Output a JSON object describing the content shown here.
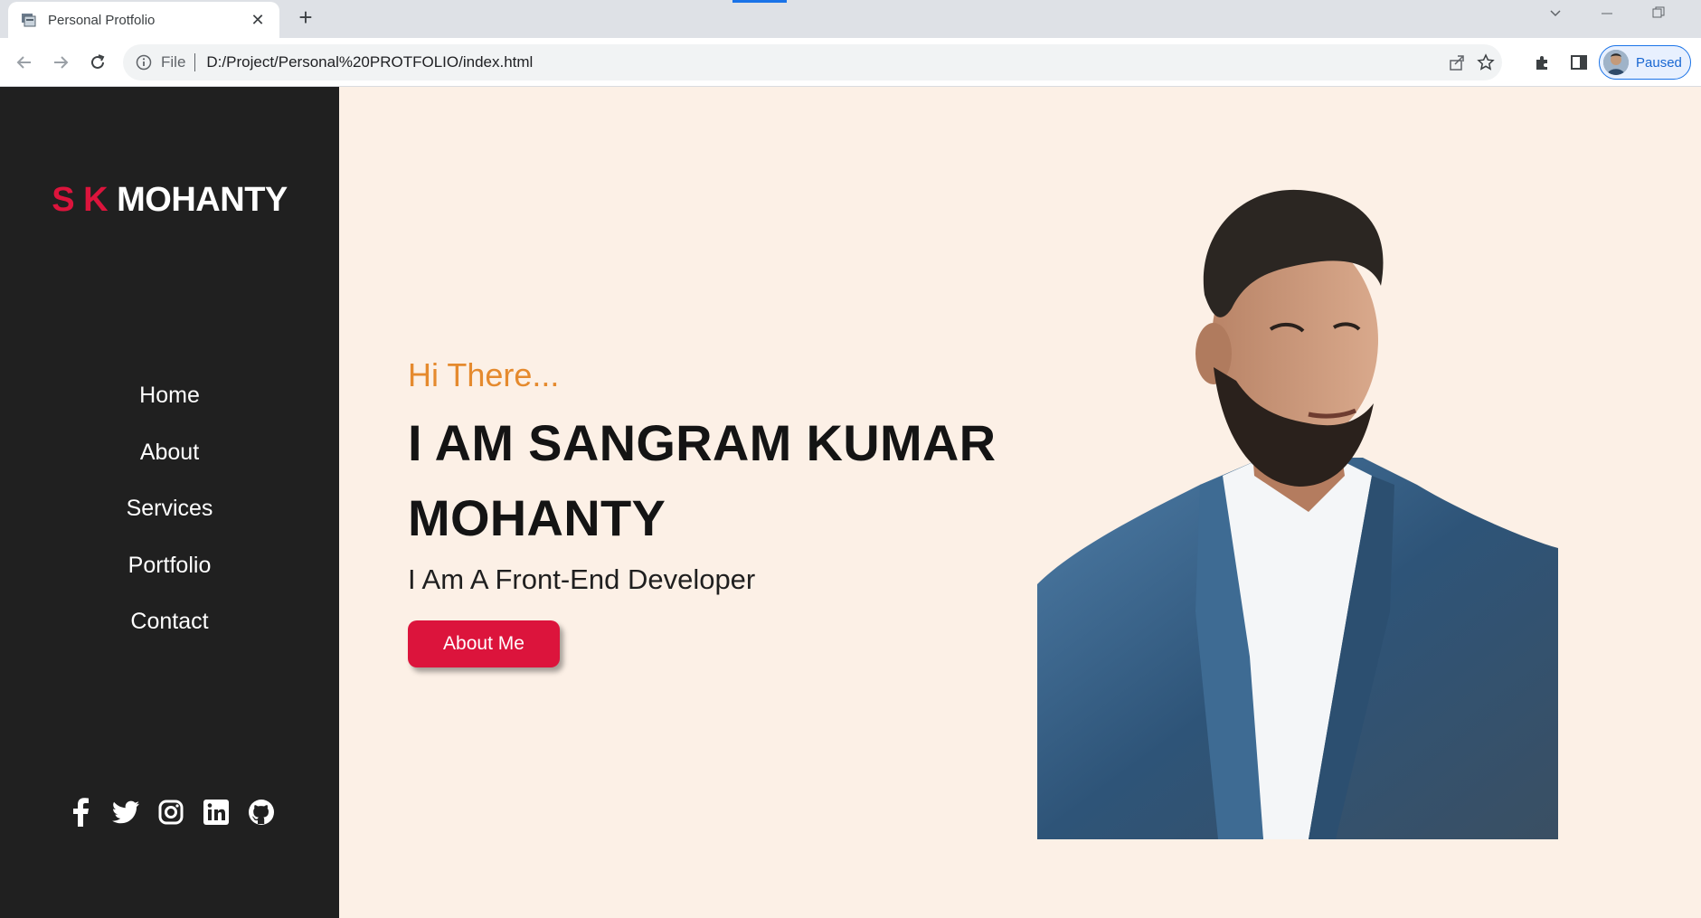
{
  "browser": {
    "tab_title": "Personal Protfolio",
    "tab_close": "✕",
    "new_tab": "+",
    "url_scheme": "File",
    "url": "D:/Project/Personal%20PROTFOLIO/index.html",
    "profile_label": "Paused",
    "accent_color": "#1a73e8"
  },
  "sidebar": {
    "logo_accent": "S K",
    "logo_main": "MOHANTY",
    "accent_color": "#dc143c",
    "nav_items": [
      {
        "label": "Home"
      },
      {
        "label": "About"
      },
      {
        "label": "Services"
      },
      {
        "label": "Portfolio"
      },
      {
        "label": "Contact"
      }
    ],
    "social_icons": [
      "facebook-icon",
      "twitter-icon",
      "instagram-icon",
      "linkedin-icon",
      "github-icon"
    ]
  },
  "hero": {
    "greeting": "Hi There...",
    "headline": "I AM SANGRAM KUMAR MOHANTY",
    "subline": "I Am A Front-End Developer",
    "cta_label": "About Me",
    "greeting_color": "#e58a2e",
    "background_color": "#fcf0e6"
  }
}
